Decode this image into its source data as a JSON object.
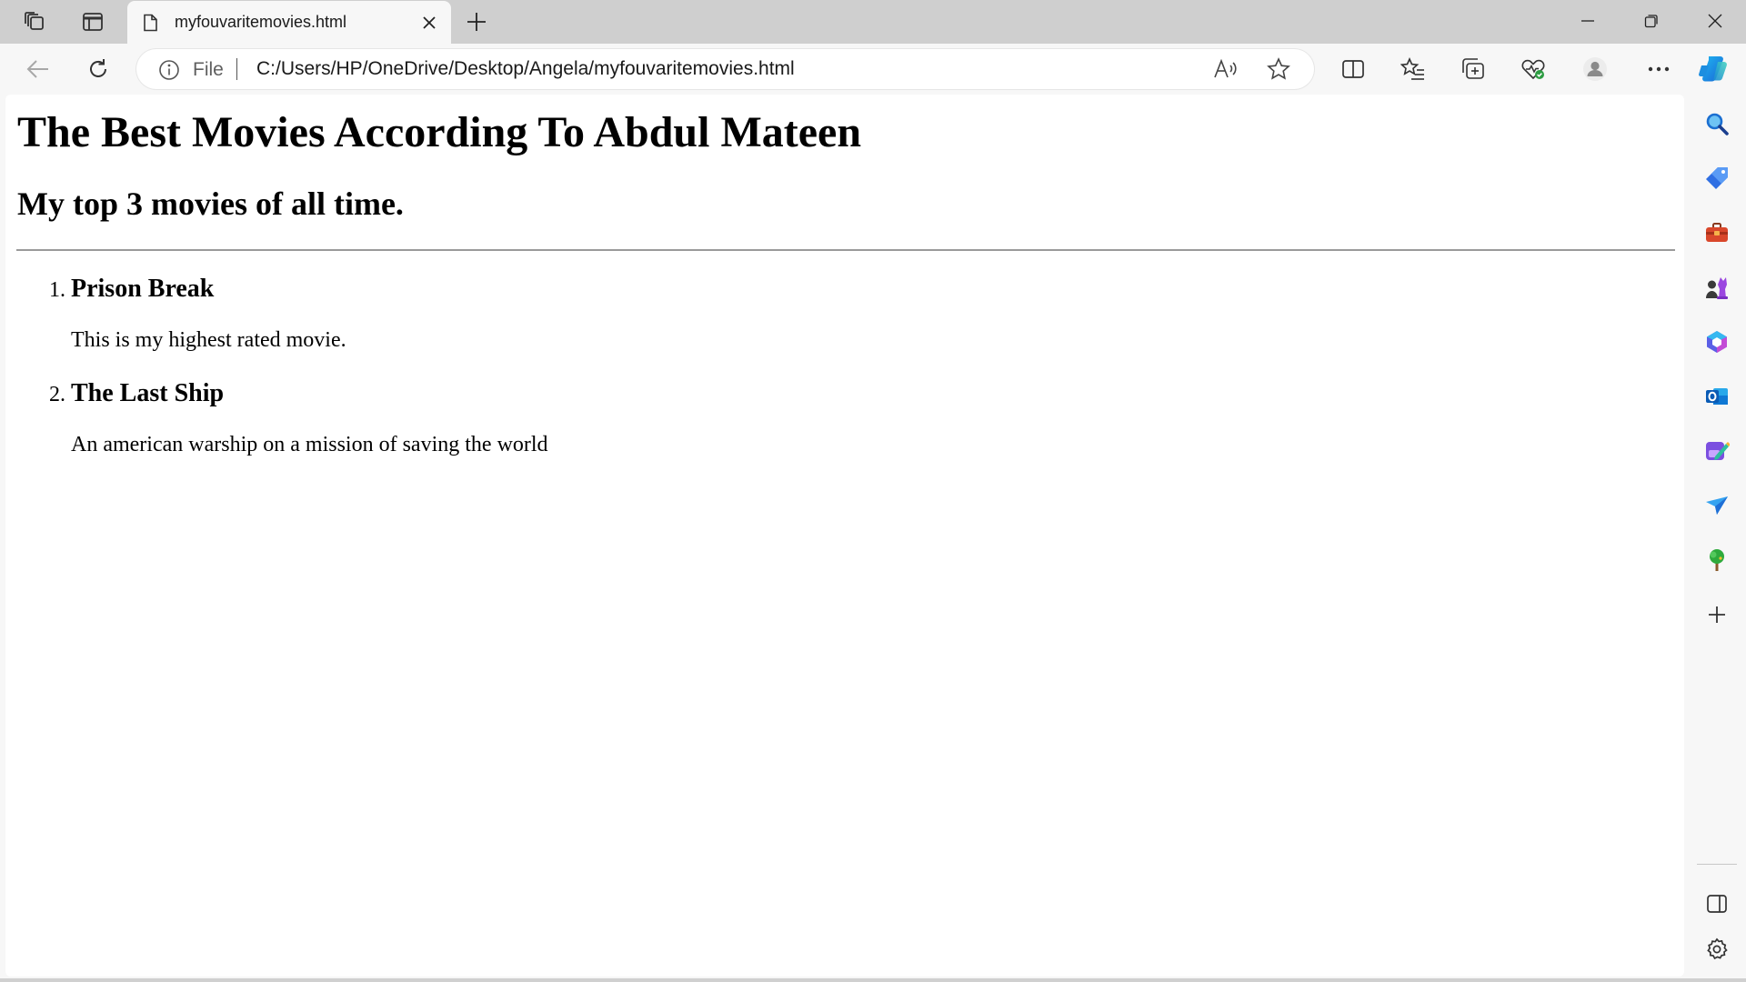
{
  "browser": {
    "tab": {
      "title": "myfouvaritemovies.html"
    },
    "address": {
      "scheme_label": "File",
      "url": "C:/Users/HP/OneDrive/Desktop/Angela/myfouvaritemovies.html"
    },
    "icons": {
      "tabstrip": [
        "workspaces-icon",
        "vertical-tabs-icon",
        "file-icon",
        "close-icon",
        "plus-icon"
      ],
      "window": [
        "minimize-icon",
        "restore-icon",
        "close-window-icon"
      ],
      "toolbar": [
        "back-arrow-icon",
        "refresh-icon",
        "info-icon",
        "read-aloud-icon",
        "star-icon",
        "split-screen-icon",
        "favorites-icon",
        "collections-icon",
        "browser-essentials-icon",
        "profile-icon",
        "more-icon",
        "copilot-icon"
      ],
      "sidebar": [
        "search-icon",
        "shopping-tag-icon",
        "tools-icon",
        "games-icon",
        "microsoft-365-icon",
        "outlook-icon",
        "designer-icon",
        "send-icon",
        "tree-icon",
        "add-icon",
        "sidebar-toggle-icon",
        "settings-icon"
      ]
    },
    "colors": {
      "tabstrip": "#cfcfcf",
      "toolbar": "#f7f7f7",
      "page": "#ffffff"
    }
  },
  "page": {
    "heading": "The Best Movies According To Abdul Mateen",
    "subheading": "My top 3 movies of all time.",
    "movies": [
      {
        "number": "1.",
        "title": "Prison Break",
        "description": "This is my highest rated movie."
      },
      {
        "number": "2.",
        "title": "The Last Ship",
        "description": "An american warship on a mission of saving the world"
      }
    ]
  }
}
